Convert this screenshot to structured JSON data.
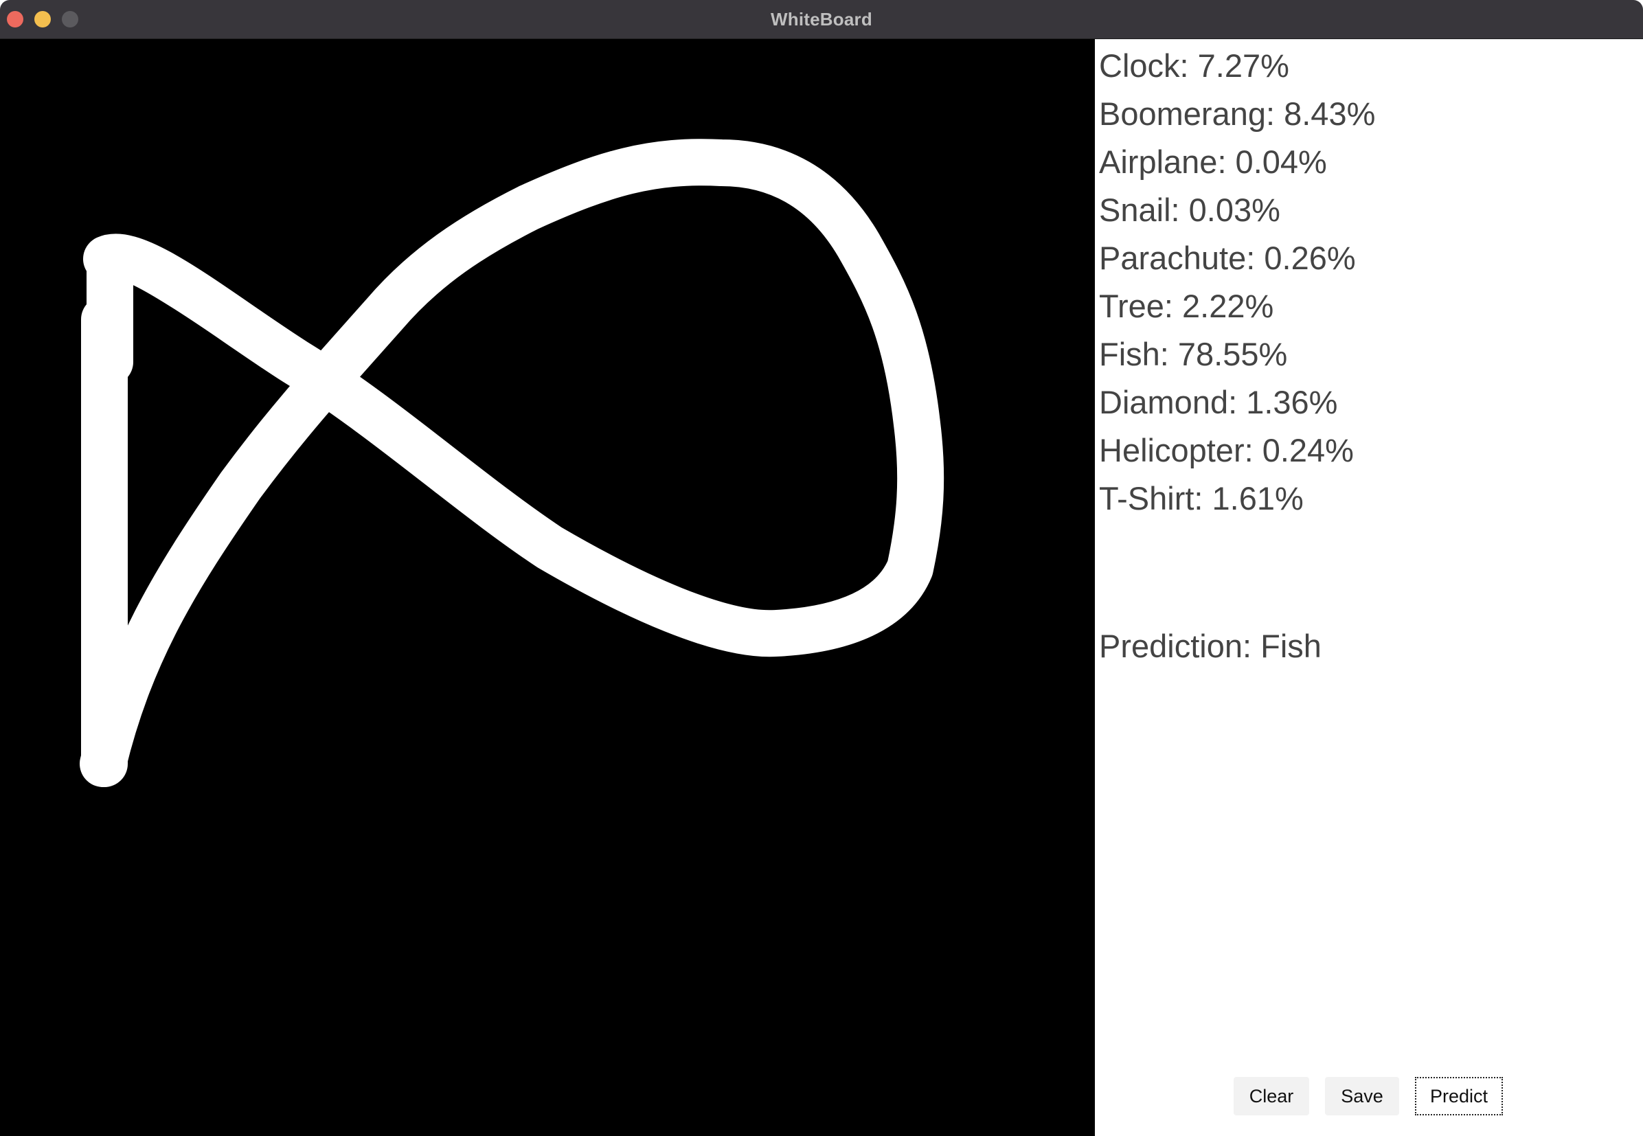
{
  "window": {
    "title": "WhiteBoard"
  },
  "canvas": {
    "background": "#000000",
    "stroke_color": "#ffffff",
    "content": "drawn-fish-sketch"
  },
  "scores": [
    "Clock: 7.27%",
    "Boomerang: 8.43%",
    "Airplane: 0.04%",
    "Snail: 0.03%",
    "Parachute: 0.26%",
    "Tree: 2.22%",
    "Fish: 78.55%",
    "Diamond: 1.36%",
    "Helicopter: 0.24%",
    "T-Shirt: 1.61%"
  ],
  "prediction": "Prediction: Fish",
  "buttons": {
    "clear": "Clear",
    "save": "Save",
    "predict": "Predict"
  },
  "colors": {
    "titlebar": "#38363b",
    "close": "#ed6a5e",
    "minimize": "#f4bf4f",
    "zoom": "#5b5a5e",
    "text": "#444444"
  }
}
